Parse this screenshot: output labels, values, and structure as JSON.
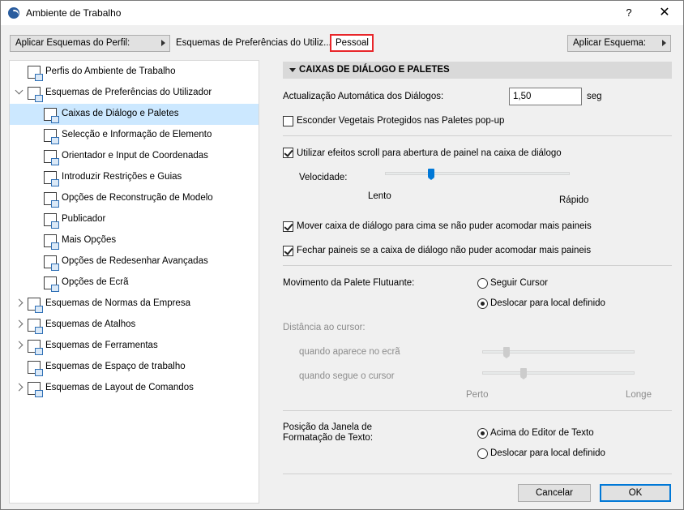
{
  "window": {
    "title": "Ambiente de Trabalho",
    "help_label": "?",
    "close_label": "✕"
  },
  "toolbar": {
    "apply_profile_label": "Aplicar Esquemas do Perfil:",
    "breadcrumb": "Esquemas de Preferências do Utiliz...",
    "current_scheme": "Pessoal",
    "apply_scheme_label": "Aplicar Esquema:"
  },
  "tree": {
    "items": [
      {
        "label": "Perfis do Ambiente de Trabalho",
        "level": 0,
        "caret": "none",
        "icon": "profiles-icon"
      },
      {
        "label": "Esquemas de Preferências do Utilizador",
        "level": 0,
        "caret": "expanded",
        "icon": "user-preferences-icon"
      },
      {
        "label": "Caixas de Diálogo e Paletes",
        "level": 1,
        "caret": "none",
        "icon": "dialog-boxes-icon",
        "selected": true
      },
      {
        "label": "Selecção e Informação de Elemento",
        "level": 1,
        "caret": "none",
        "icon": "selection-info-icon"
      },
      {
        "label": "Orientador e Input de Coordenadas",
        "level": 1,
        "caret": "none",
        "icon": "coordinates-icon"
      },
      {
        "label": "Introduzir Restrições e Guias",
        "level": 1,
        "caret": "none",
        "icon": "constraints-icon"
      },
      {
        "label": "Opções de Reconstrução de Modelo",
        "level": 1,
        "caret": "none",
        "icon": "rebuild-model-icon"
      },
      {
        "label": "Publicador",
        "level": 1,
        "caret": "none",
        "icon": "publisher-icon"
      },
      {
        "label": "Mais Opções",
        "level": 1,
        "caret": "none",
        "icon": "more-options-icon"
      },
      {
        "label": "Opções de Redesenhar Avançadas",
        "level": 1,
        "caret": "none",
        "icon": "redraw-icon"
      },
      {
        "label": "Opções de Ecrã",
        "level": 1,
        "caret": "none",
        "icon": "screen-options-icon"
      },
      {
        "label": "Esquemas de Normas da Empresa",
        "level": 0,
        "caret": "collapsed",
        "icon": "company-standards-icon"
      },
      {
        "label": "Esquemas de Atalhos",
        "level": 0,
        "caret": "collapsed",
        "icon": "shortcuts-icon"
      },
      {
        "label": "Esquemas de Ferramentas",
        "level": 0,
        "caret": "collapsed",
        "icon": "tools-icon"
      },
      {
        "label": "Esquemas de Espaço de trabalho",
        "level": 0,
        "caret": "none",
        "icon": "workspace-icon"
      },
      {
        "label": "Esquemas de Layout de Comandos",
        "level": 0,
        "caret": "collapsed",
        "icon": "command-layout-icon"
      }
    ]
  },
  "panel": {
    "section_title": "CAIXAS DE DIÁLOGO E PALETES",
    "auto_update_label": "Actualização Automática dos Diálogos:",
    "auto_update_value": "1,50",
    "auto_update_unit": "seg",
    "hide_protected_label": "Esconder Vegetais Protegidos nas Paletes pop-up",
    "hide_protected_checked": false,
    "scroll_effects_label": "Utilizar efeitos scroll para abertura de painel na caixa de diálogo",
    "scroll_effects_checked": true,
    "speed_label": "Velocidade:",
    "speed_min_label": "Lento",
    "speed_max_label": "Rápido",
    "speed_value": 0.25,
    "move_dialog_label": "Mover caixa de diálogo para cima se não puder acomodar mais paineis",
    "move_dialog_checked": true,
    "close_panels_label": "Fechar paineis se a caixa de diálogo não puder acomodar mais paineis",
    "close_panels_checked": true,
    "floating_palette_label": "Movimento da Palete Flutuante:",
    "follow_cursor_label": "Seguir Cursor",
    "move_to_location_label": "Deslocar para local definido",
    "floating_selected": "move_to_location",
    "cursor_distance_label": "Distância ao cursor:",
    "appears_label": "quando aparece no ecrã",
    "follows_label": "quando segue o cursor",
    "appears_value": 0.16,
    "follows_value": 0.27,
    "near_label": "Perto",
    "far_label": "Longe",
    "text_window_label_1": "Posição da Janela de",
    "text_window_label_2": "Formatação de Texto:",
    "above_editor_label": "Acima do Editor de Texto",
    "move_location_label_2": "Deslocar para local definido",
    "text_window_selected": "above_editor"
  },
  "buttons": {
    "cancel_label": "Cancelar",
    "ok_label": "OK"
  },
  "colors": {
    "selection": "#cce8ff",
    "accent": "#0078d7",
    "highlight_border": "#e8262a"
  }
}
